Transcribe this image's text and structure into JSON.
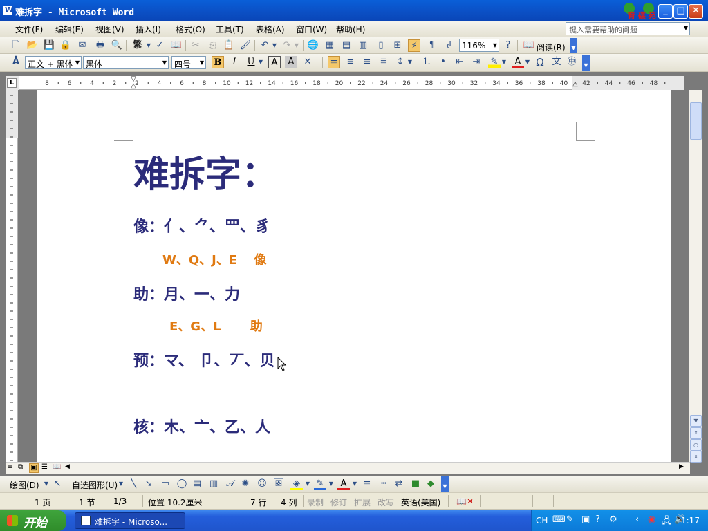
{
  "window": {
    "title": "难拆字 - Microsoft Word"
  },
  "menu": {
    "items": [
      "文件(F)",
      "编辑(E)",
      "视图(V)",
      "插入(I)",
      "格式(O)",
      "工具(T)",
      "表格(A)",
      "窗口(W)",
      "帮助(H)"
    ],
    "help_placeholder": "键入需要帮助的问题"
  },
  "toolbar_standard": {
    "traditional": "繁",
    "zoom": "116%",
    "read_label": "阅读(R)"
  },
  "toolbar_format": {
    "style": "正文 + 黑体",
    "font": "黑体",
    "size": "四号",
    "bold": "B",
    "italic": "I",
    "underline": "U",
    "char_border": "A",
    "char_shading": "A",
    "font_color": "A",
    "symbol": "Ω"
  },
  "ruler": {
    "marks": [
      "8",
      "6",
      "4",
      "2",
      "2",
      "4",
      "6",
      "8",
      "10",
      "12",
      "14",
      "16",
      "18",
      "20",
      "22",
      "24",
      "26",
      "28",
      "30",
      "32",
      "34",
      "36",
      "38",
      "40",
      "42",
      "44",
      "46",
      "48"
    ]
  },
  "document": {
    "heading": "难拆字：",
    "lines": [
      {
        "text": "像：亻、⺈、罒、豸",
        "style": "blue"
      },
      {
        "text": "W、Q、J、E　 像",
        "style": "orange"
      },
      {
        "text": "助：月、一、力",
        "style": "blue"
      },
      {
        "text": "E、G、L　　 助",
        "style": "orange"
      },
      {
        "text": "预：マ、 卩、丆、贝",
        "style": "blue"
      },
      {
        "text": "核：木、亠、乙、人",
        "style": "blue"
      }
    ]
  },
  "drawing_toolbar": {
    "draw": "绘图(D)",
    "autoshapes": "自选图形(U)"
  },
  "status": {
    "page": "1 页",
    "section": "1 节",
    "pages": "1/3",
    "position": "位置 10.2厘米",
    "line": "7 行",
    "column": "4 列",
    "rec": "录制",
    "trk": "修订",
    "ext": "扩展",
    "ovr": "改写",
    "language": "英语(美国)"
  },
  "taskbar": {
    "start": "开始",
    "task_button": "难拆字 - Microso...",
    "ime": "CH",
    "time": "1:17"
  },
  "colors": {
    "title_blue": "#0a5fd8",
    "text_blue": "#2b2b7a",
    "text_orange": "#e07a12",
    "start_green": "#3fa43c"
  }
}
